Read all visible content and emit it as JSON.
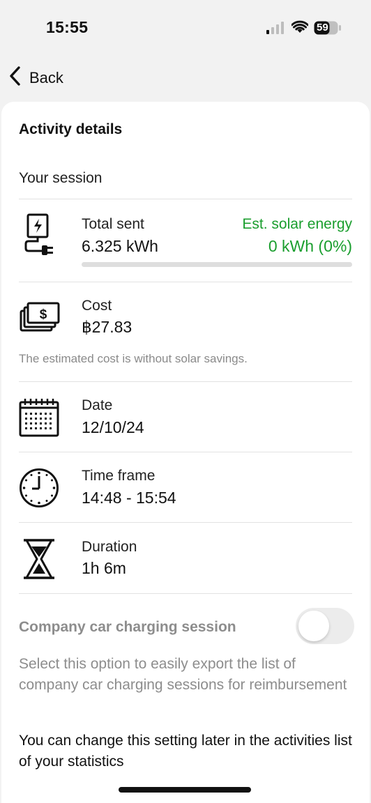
{
  "status_bar": {
    "time": "15:55",
    "battery_level": "59",
    "signal_icon": "cellular-signal-icon",
    "wifi_icon": "wifi-icon",
    "battery_icon": "battery-icon"
  },
  "nav": {
    "back_label": "Back",
    "back_icon": "chevron-left-icon"
  },
  "activity": {
    "title": "Activity details",
    "section_label": "Your session",
    "total_sent": {
      "icon": "charger-plug-icon",
      "label": "Total sent",
      "value": "6.325 kWh",
      "solar_label": "Est. solar energy",
      "solar_value": "0 kWh (0%)",
      "solar_fraction": 0
    },
    "cost": {
      "icon": "money-stack-icon",
      "label": "Cost",
      "value": "฿27.83",
      "note": "The estimated cost is without solar savings."
    },
    "date": {
      "icon": "calendar-icon",
      "label": "Date",
      "value": "12/10/24"
    },
    "time_frame": {
      "icon": "clock-icon",
      "label": "Time frame",
      "value": "14:48 - 15:54"
    },
    "duration": {
      "icon": "hourglass-icon",
      "label": "Duration",
      "value": "1h 6m"
    }
  },
  "company_car": {
    "label": "Company car charging session",
    "enabled": false,
    "description": "Select this option to easily export the list of company car charging sessions for reimbursement",
    "hint": "You can change this setting later in the activities list of your statistics"
  },
  "colors": {
    "accent_green": "#1a9e2e",
    "muted_text": "#8d8d8d",
    "background": "#f2f2f2"
  }
}
